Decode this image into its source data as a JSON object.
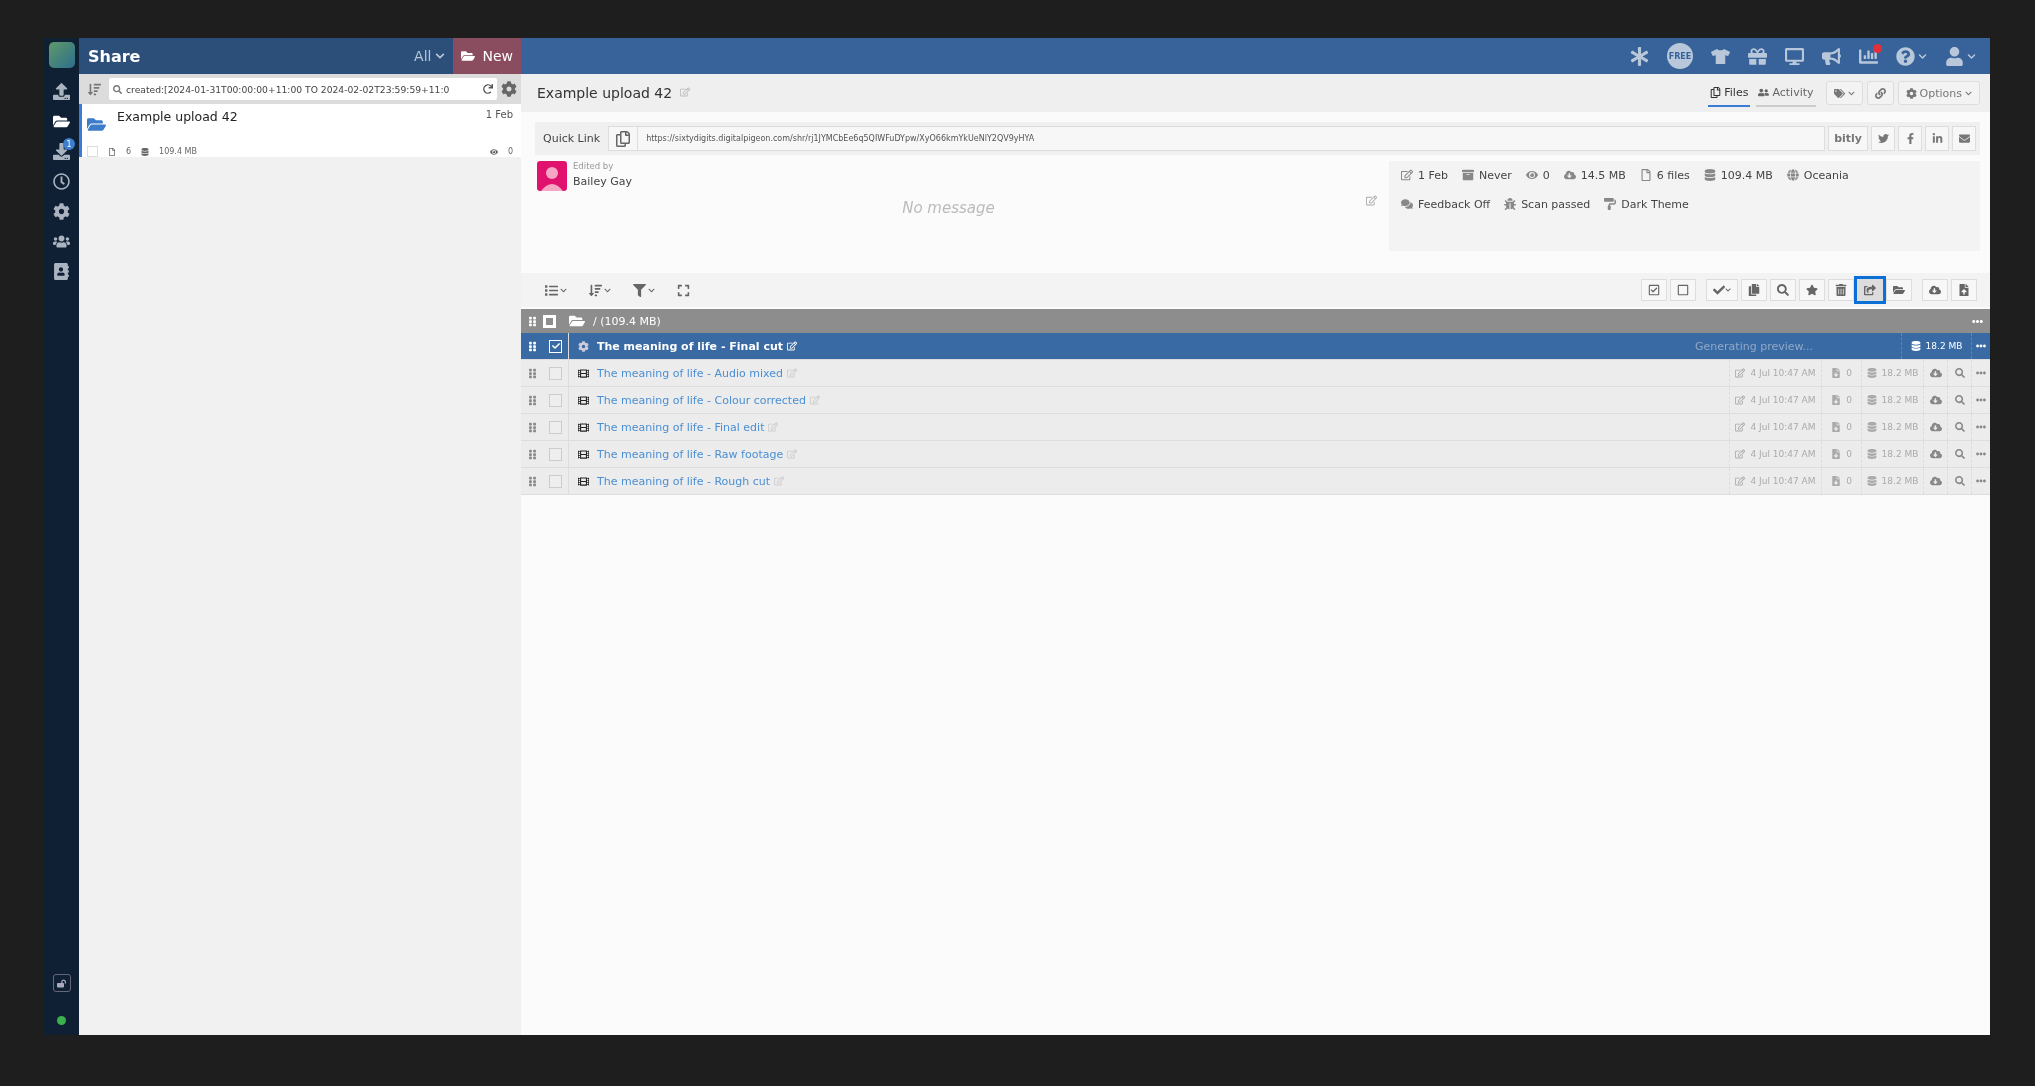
{
  "app": {
    "title": "Share",
    "filter": "All",
    "new_button": "New"
  },
  "rail": [
    {
      "kind": "upload",
      "selected": false
    },
    {
      "kind": "folder",
      "selected": true
    },
    {
      "kind": "download",
      "selected": false,
      "badge": "1"
    },
    {
      "kind": "history",
      "selected": false
    },
    {
      "kind": "settings",
      "selected": false
    },
    {
      "kind": "contacts",
      "selected": false
    },
    {
      "kind": "address-book",
      "selected": false
    }
  ],
  "header_icons": [
    {
      "kind": "asterisk",
      "alert": false
    },
    {
      "kind": "free",
      "label": "FREE",
      "alert": false
    },
    {
      "kind": "shirt",
      "alert": false
    },
    {
      "kind": "gift",
      "alert": false
    },
    {
      "kind": "monitor",
      "alert": false
    },
    {
      "kind": "megaphone",
      "alert": false
    },
    {
      "kind": "stats",
      "alert": true
    },
    {
      "kind": "help",
      "alert": false
    },
    {
      "kind": "user",
      "alert": false
    }
  ],
  "search": {
    "value": "created:[2024-01-31T00:00:00+11:00 TO 2024-02-02T23:59:59+11:0"
  },
  "uploads": [
    {
      "title": "Example upload 42",
      "date": "1 Feb",
      "files": "6",
      "size": "109.4 MB",
      "views": "0",
      "selected": true,
      "checked": false
    }
  ],
  "upload": {
    "title": "Example upload 42"
  },
  "tabs": [
    {
      "label": "Files",
      "selected": true
    },
    {
      "label": "Activity",
      "selected": false
    }
  ],
  "options_button": "Options",
  "quick_link": {
    "label": "Quick Link",
    "url": "https://sixtydigits.digitalpigeon.com/shr/rj1JYMCbEe6q5QIWFuDYpw/XyO66kmYkUeNlY2QV9yHYA",
    "shortener": "bitly"
  },
  "editor": {
    "caption": "Edited by",
    "name": "Bailey Gay",
    "message_placeholder": "No message"
  },
  "stats": [
    {
      "kind": "edited",
      "text": "1 Feb"
    },
    {
      "kind": "expiry",
      "text": "Never"
    },
    {
      "kind": "views",
      "text": "0"
    },
    {
      "kind": "downloaded",
      "text": "14.5 MB"
    },
    {
      "kind": "files",
      "text": "6 files"
    },
    {
      "kind": "size",
      "text": "109.4 MB"
    },
    {
      "kind": "region",
      "text": "Oceania"
    },
    {
      "kind": "feedback",
      "text": "Feedback Off"
    },
    {
      "kind": "scan",
      "text": "Scan passed"
    },
    {
      "kind": "theme",
      "text": "Dark Theme"
    }
  ],
  "tools": [
    {
      "kind": "check-all",
      "highlighted": false
    },
    {
      "kind": "uncheck-all",
      "highlighted": false
    },
    {
      "kind": "approve",
      "highlighted": false
    },
    {
      "kind": "copy",
      "highlighted": false
    },
    {
      "kind": "preview",
      "highlighted": false
    },
    {
      "kind": "favourite",
      "highlighted": false
    },
    {
      "kind": "delete",
      "highlighted": false
    },
    {
      "kind": "share",
      "highlighted": true
    },
    {
      "kind": "move",
      "highlighted": false
    },
    {
      "kind": "download",
      "highlighted": false
    },
    {
      "kind": "upload",
      "highlighted": false
    }
  ],
  "folder": {
    "label": "/ (109.4 MB)",
    "checked": false
  },
  "files": [
    {
      "kind": "processing",
      "name": "The meaning of life - Final cut",
      "selected": true,
      "checked": true,
      "status": "Generating preview...",
      "size": "18.2 MB"
    },
    {
      "kind": "video",
      "name": "The meaning of life - Audio mixed",
      "selected": false,
      "checked": false,
      "modified": "4 Jul 10:47 AM",
      "downloads": "0",
      "size": "18.2 MB"
    },
    {
      "kind": "video",
      "name": "The meaning of life - Colour corrected",
      "selected": false,
      "checked": false,
      "modified": "4 Jul 10:47 AM",
      "downloads": "0",
      "size": "18.2 MB"
    },
    {
      "kind": "video",
      "name": "The meaning of life - Final edit",
      "selected": false,
      "checked": false,
      "modified": "4 Jul 10:47 AM",
      "downloads": "0",
      "size": "18.2 MB"
    },
    {
      "kind": "video",
      "name": "The meaning of life - Raw footage",
      "selected": false,
      "checked": false,
      "modified": "4 Jul 10:47 AM",
      "downloads": "0",
      "size": "18.2 MB"
    },
    {
      "kind": "video",
      "name": "The meaning of life - Rough cut",
      "selected": false,
      "checked": false,
      "modified": "4 Jul 10:47 AM",
      "downloads": "0",
      "size": "18.2 MB"
    }
  ]
}
